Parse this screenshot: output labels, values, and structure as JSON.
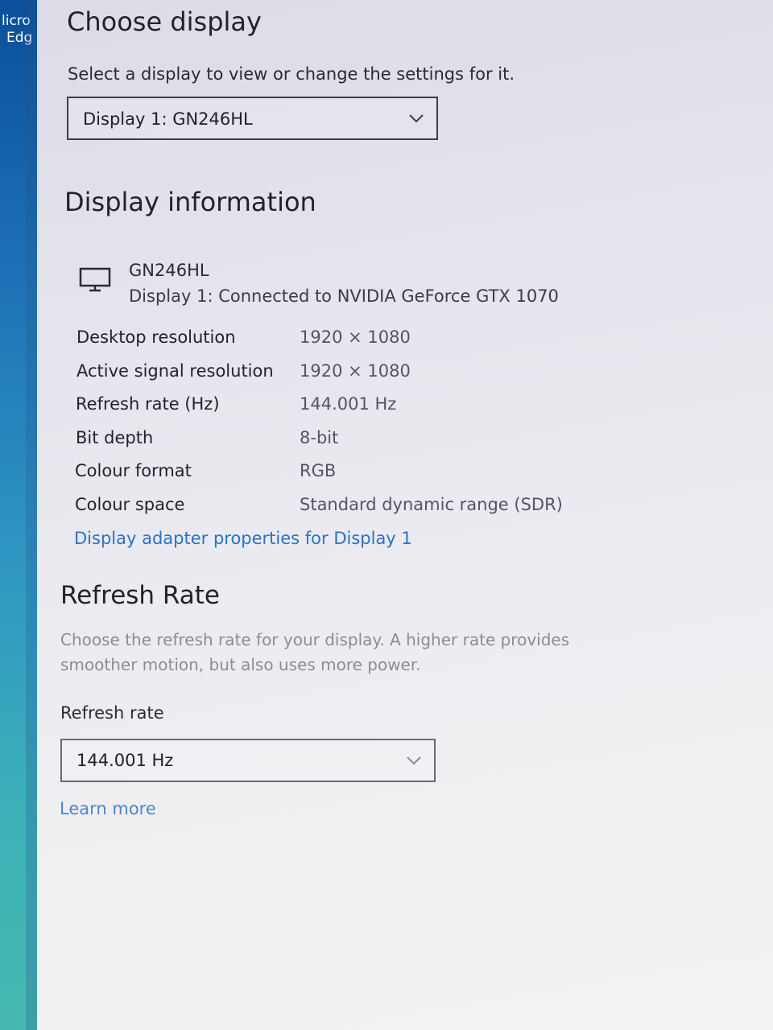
{
  "taskbar": {
    "app_label_line1": "licro",
    "app_label_line2": "Edg"
  },
  "choose_display": {
    "title": "Choose display",
    "description": "Select a display to view or change the settings for it.",
    "dropdown_value": "Display 1: GN246HL"
  },
  "display_information": {
    "title": "Display information",
    "monitor_name": "GN246HL",
    "monitor_subtitle": "Display 1: Connected to NVIDIA GeForce GTX 1070",
    "rows": [
      {
        "label": "Desktop resolution",
        "value": "1920 × 1080"
      },
      {
        "label": "Active signal resolution",
        "value": "1920 × 1080"
      },
      {
        "label": "Refresh rate (Hz)",
        "value": "144.001 Hz"
      },
      {
        "label": "Bit depth",
        "value": "8-bit"
      },
      {
        "label": "Colour format",
        "value": "RGB"
      },
      {
        "label": "Colour space",
        "value": "Standard dynamic range (SDR)"
      }
    ],
    "adapter_link": "Display adapter properties for Display 1"
  },
  "refresh_rate": {
    "title": "Refresh Rate",
    "description": "Choose the refresh rate for your display. A higher rate provides smoother motion, but also uses more power.",
    "field_label": "Refresh rate",
    "dropdown_value": "144.001 Hz",
    "learn_more": "Learn more"
  },
  "colors": {
    "link": "#2a72c8",
    "heading": "#222228",
    "muted": "#8c8c94",
    "desktop_blue": "#1c6fb6"
  },
  "icons": [
    "monitor-icon",
    "chevron-down-icon"
  ]
}
